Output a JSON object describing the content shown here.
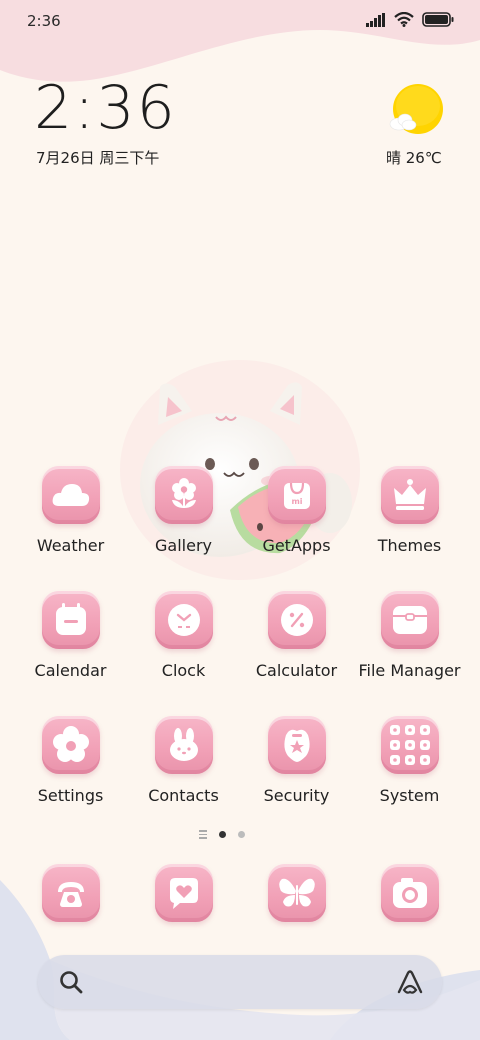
{
  "status_bar": {
    "time": "2:36",
    "icons": [
      "signal-icon",
      "wifi-icon",
      "battery-icon"
    ]
  },
  "clock_widget": {
    "time": "2:36",
    "date": "7月26日 周三下午"
  },
  "weather_widget": {
    "text": "晴 26℃",
    "icon": "sun-cloud-icon"
  },
  "apps": [
    {
      "label": "Weather",
      "icon": "cloud-icon"
    },
    {
      "label": "Gallery",
      "icon": "flower-icon"
    },
    {
      "label": "GetApps",
      "icon": "shopping-bag-icon"
    },
    {
      "label": "Themes",
      "icon": "crown-icon"
    },
    {
      "label": "Calendar",
      "icon": "calendar-icon"
    },
    {
      "label": "Clock",
      "icon": "clock-icon"
    },
    {
      "label": "Calculator",
      "icon": "calculator-icon"
    },
    {
      "label": "File Manager",
      "icon": "folder-icon"
    },
    {
      "label": "Settings",
      "icon": "flower-gear-icon"
    },
    {
      "label": "Contacts",
      "icon": "bunny-icon"
    },
    {
      "label": "Security",
      "icon": "shield-icon"
    },
    {
      "label": "System",
      "icon": "grid-icon"
    }
  ],
  "page_indicator": {
    "pages": 2,
    "current": 1
  },
  "dock": [
    {
      "icon": "phone-icon"
    },
    {
      "icon": "message-heart-icon"
    },
    {
      "icon": "butterfly-icon"
    },
    {
      "icon": "camera-icon"
    }
  ],
  "search_bar": {
    "left_icon": "search-icon",
    "right_icon": "assistant-icon"
  },
  "colors": {
    "app_icon_pink": "#f4a9bd",
    "background_cream": "#fdf6ef",
    "top_wave_pink": "#f7dde0",
    "bottom_wave_lavender": "#dfe2ee",
    "sun_yellow": "#ffd400"
  }
}
